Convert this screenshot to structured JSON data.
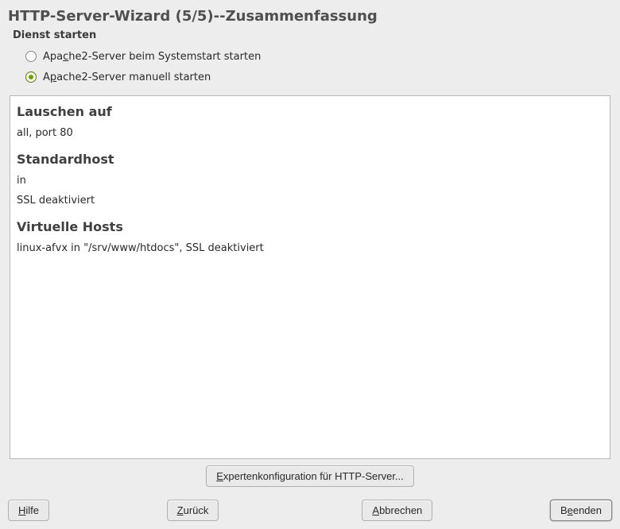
{
  "title": "HTTP-Server-Wizard (5/5)--Zusammenfassung",
  "service_section": {
    "label": "Dienst starten",
    "options": {
      "boot": {
        "pre": "Apa",
        "u": "c",
        "post": "he2-Server beim Systemstart starten",
        "selected": false
      },
      "manual": {
        "pre": "A",
        "u": "p",
        "post": "ache2-Server manuell starten",
        "selected": true
      }
    }
  },
  "summary": {
    "listen": {
      "heading": "Lauschen auf",
      "value": "all, port 80"
    },
    "default_host": {
      "heading": "Standardhost",
      "line1": "in",
      "line2": "SSL deaktiviert"
    },
    "vhosts": {
      "heading": "Virtuelle Hosts",
      "value": "linux-afvx in \"/srv/www/htdocs\", SSL deaktiviert"
    }
  },
  "buttons": {
    "expert": {
      "pre": "",
      "u": "E",
      "post": "xpertenkonfiguration für HTTP-Server..."
    },
    "help": {
      "pre": "",
      "u": "H",
      "post": "ilfe"
    },
    "back": {
      "pre": "",
      "u": "Z",
      "post": "urück"
    },
    "cancel": {
      "pre": "",
      "u": "A",
      "post": "bbrechen"
    },
    "finish": {
      "pre": "B",
      "u": "e",
      "post": "enden"
    }
  }
}
